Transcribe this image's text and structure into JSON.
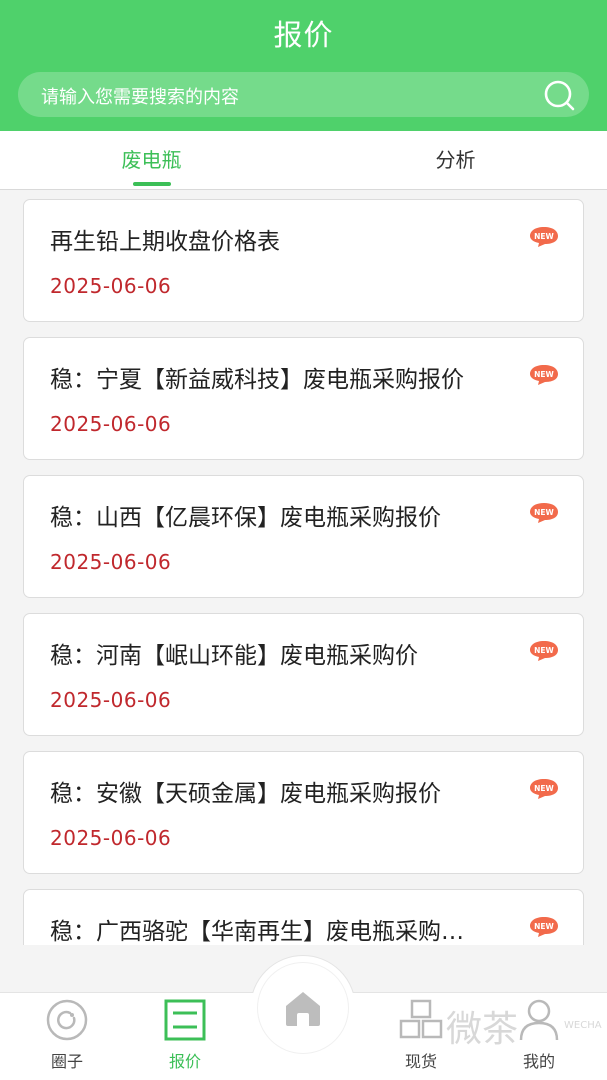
{
  "header": {
    "title": "报价",
    "search_placeholder": "请输入您需要搜索的内容"
  },
  "tabs": [
    {
      "label": "废电瓶",
      "active": true
    },
    {
      "label": "分析",
      "active": false
    }
  ],
  "list": [
    {
      "title": "再生铅上期收盘价格表",
      "date": "2025-06-06",
      "badge": "NEW"
    },
    {
      "title": "稳：宁夏【新益威科技】废电瓶采购报价",
      "date": "2025-06-06",
      "badge": "NEW"
    },
    {
      "title": "稳：山西【亿晨环保】废电瓶采购报价",
      "date": "2025-06-06",
      "badge": "NEW"
    },
    {
      "title": "稳：河南【岷山环能】废电瓶采购价",
      "date": "2025-06-06",
      "badge": "NEW"
    },
    {
      "title": "稳：安徽【天硕金属】废电瓶采购报价",
      "date": "2025-06-06",
      "badge": "NEW"
    },
    {
      "title": "稳：广西骆驼【华南再生】废电瓶采购…",
      "date": "",
      "badge": "NEW"
    }
  ],
  "bottom_nav": [
    {
      "label": "圈子",
      "icon": "circle-icon",
      "active": false
    },
    {
      "label": "报价",
      "icon": "list-icon",
      "active": true
    },
    {
      "label": "",
      "icon": "home-icon",
      "active": false
    },
    {
      "label": "现货",
      "icon": "boxes-icon",
      "active": false
    },
    {
      "label": "我的",
      "icon": "user-icon",
      "active": false
    }
  ],
  "watermark": {
    "text": "微茶",
    "sub": "WECHA"
  },
  "colors": {
    "brand_green": "#4fd16b",
    "active_green": "#3cbf57",
    "date_red": "#c0282d",
    "badge_orange": "#f26a4b"
  }
}
